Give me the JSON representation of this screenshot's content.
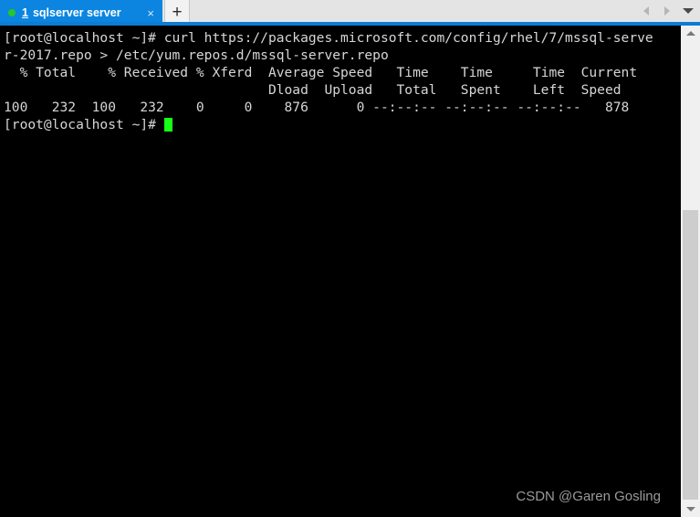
{
  "window": {
    "accent_color": "#0c7cd5",
    "tabbar_bg": "#e4e4e4"
  },
  "tabbar": {
    "tabs": [
      {
        "index": "1",
        "title": "sqlserver server",
        "status_dot_color": "#26c728",
        "close_label": "×",
        "active": true
      }
    ],
    "new_tab_label": "+",
    "nav_prev_label": "",
    "nav_next_label": "",
    "menu_label": ""
  },
  "terminal": {
    "background_color": "#000000",
    "foreground_color": "#d6d6d6",
    "cursor_color": "#17ff17",
    "lines": [
      "[root@localhost ~]# curl https://packages.microsoft.com/config/rhel/7/mssql-serve",
      "r-2017.repo > /etc/yum.repos.d/mssql-server.repo",
      "  % Total    % Received % Xferd  Average Speed   Time    Time     Time  Current",
      "                                 Dload  Upload   Total   Spent    Left  Speed",
      "100   232  100   232    0     0    876      0 --:--:-- --:--:-- --:--:--   878",
      "[root@localhost ~]# "
    ],
    "prompt_line_index": 5,
    "cursor_visible": true
  },
  "watermark": {
    "text": "CSDN @Garen Gosling"
  },
  "scrollbar": {
    "up_label": "",
    "down_label": "",
    "thumb_title": ""
  }
}
